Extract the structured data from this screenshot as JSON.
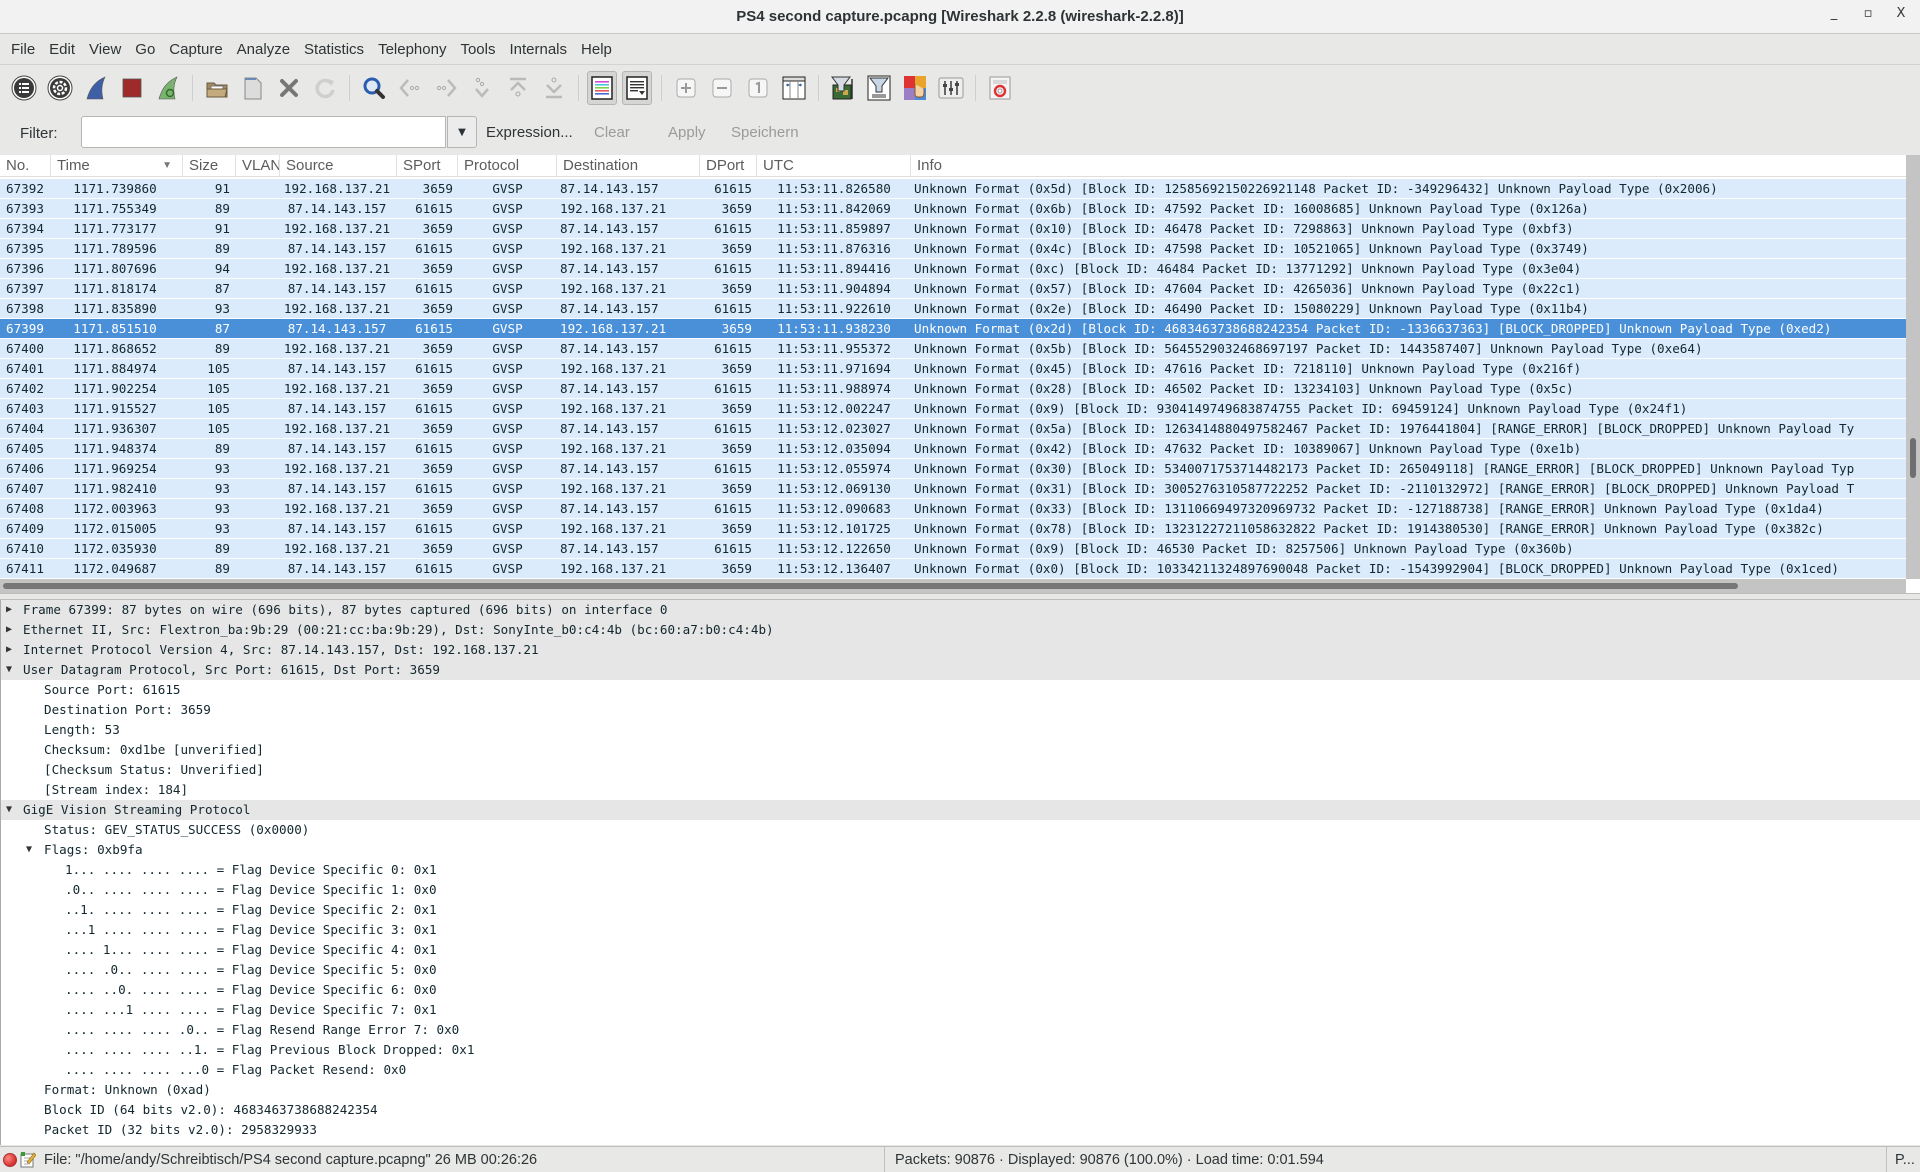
{
  "window": {
    "title": "PS4 second capture.pcapng [Wireshark 2.2.8 (wireshark-2.2.8)]",
    "minimize": "_",
    "maximize": "▫",
    "close": "X"
  },
  "menu": [
    "File",
    "Edit",
    "View",
    "Go",
    "Capture",
    "Analyze",
    "Statistics",
    "Telephony",
    "Tools",
    "Internals",
    "Help"
  ],
  "toolbar": {
    "buttons": [
      "capture-interfaces-icon",
      "capture-options-icon",
      "start-capture-icon",
      "stop-capture-icon",
      "restart-capture-icon",
      "open-file-icon",
      "save-file-icon",
      "close-file-icon",
      "reload-file-icon",
      "find-packet-icon",
      "go-back-icon",
      "go-forward-icon",
      "go-to-packet-icon",
      "go-first-packet-icon",
      "go-last-packet-icon",
      "colorize-icon",
      "auto-scroll-icon",
      "zoom-in-icon",
      "zoom-out-icon",
      "normal-size-icon",
      "resize-columns-icon",
      "capture-filters-icon",
      "display-filters-icon",
      "coloring-rules-icon",
      "preferences-icon",
      "help-icon"
    ]
  },
  "filter": {
    "label": "Filter:",
    "value": "",
    "expression": "Expression...",
    "clear": "Clear",
    "apply": "Apply",
    "save": "Speichern"
  },
  "columns": [
    "No.",
    "Time",
    "Size",
    "VLAN",
    "Source",
    "SPort",
    "Protocol",
    "Destination",
    "DPort",
    "UTC",
    "Info"
  ],
  "packets": [
    {
      "no": "67392",
      "time": "1171.739860",
      "size": "91",
      "vlan": "",
      "src": "192.168.137.21",
      "sport": "3659",
      "proto": "GVSP",
      "dst": "87.14.143.157",
      "dport": "61615",
      "utc": "11:53:11.826580",
      "info": "Unknown Format (0x5d) [Block ID: 12585692150226921148 Packet ID: -349296432] Unknown Payload Type (0x2006)"
    },
    {
      "no": "67393",
      "time": "1171.755349",
      "size": "89",
      "vlan": "",
      "src": "87.14.143.157",
      "sport": "61615",
      "proto": "GVSP",
      "dst": "192.168.137.21",
      "dport": "3659",
      "utc": "11:53:11.842069",
      "info": "Unknown Format (0x6b) [Block ID: 47592 Packet ID: 16008685] Unknown Payload Type (0x126a)"
    },
    {
      "no": "67394",
      "time": "1171.773177",
      "size": "91",
      "vlan": "",
      "src": "192.168.137.21",
      "sport": "3659",
      "proto": "GVSP",
      "dst": "87.14.143.157",
      "dport": "61615",
      "utc": "11:53:11.859897",
      "info": "Unknown Format (0x10) [Block ID: 46478 Packet ID: 7298863] Unknown Payload Type (0xbf3)"
    },
    {
      "no": "67395",
      "time": "1171.789596",
      "size": "89",
      "vlan": "",
      "src": "87.14.143.157",
      "sport": "61615",
      "proto": "GVSP",
      "dst": "192.168.137.21",
      "dport": "3659",
      "utc": "11:53:11.876316",
      "info": "Unknown Format (0x4c) [Block ID: 47598 Packet ID: 10521065] Unknown Payload Type (0x3749)"
    },
    {
      "no": "67396",
      "time": "1171.807696",
      "size": "94",
      "vlan": "",
      "src": "192.168.137.21",
      "sport": "3659",
      "proto": "GVSP",
      "dst": "87.14.143.157",
      "dport": "61615",
      "utc": "11:53:11.894416",
      "info": "Unknown Format (0xc) [Block ID: 46484 Packet ID: 13771292] Unknown Payload Type (0x3e04)"
    },
    {
      "no": "67397",
      "time": "1171.818174",
      "size": "87",
      "vlan": "",
      "src": "87.14.143.157",
      "sport": "61615",
      "proto": "GVSP",
      "dst": "192.168.137.21",
      "dport": "3659",
      "utc": "11:53:11.904894",
      "info": "Unknown Format (0x57) [Block ID: 47604 Packet ID: 4265036] Unknown Payload Type (0x22c1)"
    },
    {
      "no": "67398",
      "time": "1171.835890",
      "size": "93",
      "vlan": "",
      "src": "192.168.137.21",
      "sport": "3659",
      "proto": "GVSP",
      "dst": "87.14.143.157",
      "dport": "61615",
      "utc": "11:53:11.922610",
      "info": "Unknown Format (0x2e) [Block ID: 46490 Packet ID: 15080229] Unknown Payload Type (0x11b4)"
    },
    {
      "no": "67399",
      "time": "1171.851510",
      "size": "87",
      "vlan": "",
      "src": "87.14.143.157",
      "sport": "61615",
      "proto": "GVSP",
      "dst": "192.168.137.21",
      "dport": "3659",
      "utc": "11:53:11.938230",
      "info": "Unknown Format (0x2d) [Block ID: 4683463738688242354 Packet ID: -1336637363] [BLOCK_DROPPED] Unknown Payload Type (0xed2)",
      "selected": true
    },
    {
      "no": "67400",
      "time": "1171.868652",
      "size": "89",
      "vlan": "",
      "src": "192.168.137.21",
      "sport": "3659",
      "proto": "GVSP",
      "dst": "87.14.143.157",
      "dport": "61615",
      "utc": "11:53:11.955372",
      "info": "Unknown Format (0x5b) [Block ID: 5645529032468697197 Packet ID: 1443587407] Unknown Payload Type (0xe64)"
    },
    {
      "no": "67401",
      "time": "1171.884974",
      "size": "105",
      "vlan": "",
      "src": "87.14.143.157",
      "sport": "61615",
      "proto": "GVSP",
      "dst": "192.168.137.21",
      "dport": "3659",
      "utc": "11:53:11.971694",
      "info": "Unknown Format (0x45) [Block ID: 47616 Packet ID: 7218110] Unknown Payload Type (0x216f)"
    },
    {
      "no": "67402",
      "time": "1171.902254",
      "size": "105",
      "vlan": "",
      "src": "192.168.137.21",
      "sport": "3659",
      "proto": "GVSP",
      "dst": "87.14.143.157",
      "dport": "61615",
      "utc": "11:53:11.988974",
      "info": "Unknown Format (0x28) [Block ID: 46502 Packet ID: 13234103] Unknown Payload Type (0x5c)"
    },
    {
      "no": "67403",
      "time": "1171.915527",
      "size": "105",
      "vlan": "",
      "src": "87.14.143.157",
      "sport": "61615",
      "proto": "GVSP",
      "dst": "192.168.137.21",
      "dport": "3659",
      "utc": "11:53:12.002247",
      "info": "Unknown Format (0x9) [Block ID: 9304149749683874755 Packet ID: 69459124] Unknown Payload Type (0x24f1)"
    },
    {
      "no": "67404",
      "time": "1171.936307",
      "size": "105",
      "vlan": "",
      "src": "192.168.137.21",
      "sport": "3659",
      "proto": "GVSP",
      "dst": "87.14.143.157",
      "dport": "61615",
      "utc": "11:53:12.023027",
      "info": "Unknown Format (0x5a) [Block ID: 1263414880497582467 Packet ID: 1976441804] [RANGE_ERROR] [BLOCK_DROPPED] Unknown Payload Ty"
    },
    {
      "no": "67405",
      "time": "1171.948374",
      "size": "89",
      "vlan": "",
      "src": "87.14.143.157",
      "sport": "61615",
      "proto": "GVSP",
      "dst": "192.168.137.21",
      "dport": "3659",
      "utc": "11:53:12.035094",
      "info": "Unknown Format (0x42) [Block ID: 47632 Packet ID: 10389067] Unknown Payload Type (0xe1b)"
    },
    {
      "no": "67406",
      "time": "1171.969254",
      "size": "93",
      "vlan": "",
      "src": "192.168.137.21",
      "sport": "3659",
      "proto": "GVSP",
      "dst": "87.14.143.157",
      "dport": "61615",
      "utc": "11:53:12.055974",
      "info": "Unknown Format (0x30) [Block ID: 5340071753714482173 Packet ID: 265049118] [RANGE_ERROR] [BLOCK_DROPPED] Unknown Payload Typ"
    },
    {
      "no": "67407",
      "time": "1171.982410",
      "size": "93",
      "vlan": "",
      "src": "87.14.143.157",
      "sport": "61615",
      "proto": "GVSP",
      "dst": "192.168.137.21",
      "dport": "3659",
      "utc": "11:53:12.069130",
      "info": "Unknown Format (0x31) [Block ID: 3005276310587722252 Packet ID: -2110132972] [RANGE_ERROR] [BLOCK_DROPPED] Unknown Payload T"
    },
    {
      "no": "67408",
      "time": "1172.003963",
      "size": "93",
      "vlan": "",
      "src": "192.168.137.21",
      "sport": "3659",
      "proto": "GVSP",
      "dst": "87.14.143.157",
      "dport": "61615",
      "utc": "11:53:12.090683",
      "info": "Unknown Format (0x33) [Block ID: 13110669497320969732 Packet ID: -127188738] [RANGE_ERROR] Unknown Payload Type (0x1da4)"
    },
    {
      "no": "67409",
      "time": "1172.015005",
      "size": "93",
      "vlan": "",
      "src": "87.14.143.157",
      "sport": "61615",
      "proto": "GVSP",
      "dst": "192.168.137.21",
      "dport": "3659",
      "utc": "11:53:12.101725",
      "info": "Unknown Format (0x78) [Block ID: 13231227211058632822 Packet ID: 1914380530] [RANGE_ERROR] Unknown Payload Type (0x382c)"
    },
    {
      "no": "67410",
      "time": "1172.035930",
      "size": "89",
      "vlan": "",
      "src": "192.168.137.21",
      "sport": "3659",
      "proto": "GVSP",
      "dst": "87.14.143.157",
      "dport": "61615",
      "utc": "11:53:12.122650",
      "info": "Unknown Format (0x9) [Block ID: 46530 Packet ID: 8257506] Unknown Payload Type (0x360b)"
    },
    {
      "no": "67411",
      "time": "1172.049687",
      "size": "89",
      "vlan": "",
      "src": "87.14.143.157",
      "sport": "61615",
      "proto": "GVSP",
      "dst": "192.168.137.21",
      "dport": "3659",
      "utc": "11:53:12.136407",
      "info": "Unknown Format (0x0) [Block ID: 10334211324897690048 Packet ID: -1543992904] [BLOCK_DROPPED] Unknown Payload Type (0x1ced)"
    }
  ],
  "details": [
    {
      "level": 0,
      "toggle": "collapsed",
      "section": true,
      "text": "Frame 67399: 87 bytes on wire (696 bits), 87 bytes captured (696 bits) on interface 0"
    },
    {
      "level": 0,
      "toggle": "collapsed",
      "section": true,
      "text": "Ethernet II, Src: Flextron_ba:9b:29 (00:21:cc:ba:9b:29), Dst: SonyInte_b0:c4:4b (bc:60:a7:b0:c4:4b)"
    },
    {
      "level": 0,
      "toggle": "collapsed",
      "section": true,
      "text": "Internet Protocol Version 4, Src: 87.14.143.157, Dst: 192.168.137.21"
    },
    {
      "level": 0,
      "toggle": "expanded",
      "section": true,
      "text": "User Datagram Protocol, Src Port: 61615, Dst Port: 3659"
    },
    {
      "level": 1,
      "text": "Source Port: 61615"
    },
    {
      "level": 1,
      "text": "Destination Port: 3659"
    },
    {
      "level": 1,
      "text": "Length: 53"
    },
    {
      "level": 1,
      "text": "Checksum: 0xd1be [unverified]"
    },
    {
      "level": 1,
      "text": "[Checksum Status: Unverified]"
    },
    {
      "level": 1,
      "text": "[Stream index: 184]"
    },
    {
      "level": 0,
      "toggle": "expanded",
      "section": true,
      "text": "GigE Vision Streaming Protocol"
    },
    {
      "level": 1,
      "text": "Status: GEV_STATUS_SUCCESS (0x0000)"
    },
    {
      "level": 1,
      "toggle": "expanded",
      "text": "Flags: 0xb9fa"
    },
    {
      "level": 2,
      "text": "1... .... .... .... = Flag Device Specific 0: 0x1"
    },
    {
      "level": 2,
      "text": ".0.. .... .... .... = Flag Device Specific 1: 0x0"
    },
    {
      "level": 2,
      "text": "..1. .... .... .... = Flag Device Specific 2: 0x1"
    },
    {
      "level": 2,
      "text": "...1 .... .... .... = Flag Device Specific 3: 0x1"
    },
    {
      "level": 2,
      "text": ".... 1... .... .... = Flag Device Specific 4: 0x1"
    },
    {
      "level": 2,
      "text": ".... .0.. .... .... = Flag Device Specific 5: 0x0"
    },
    {
      "level": 2,
      "text": ".... ..0. .... .... = Flag Device Specific 6: 0x0"
    },
    {
      "level": 2,
      "text": ".... ...1 .... .... = Flag Device Specific 7: 0x1"
    },
    {
      "level": 2,
      "text": ".... .... .... .0.. = Flag Resend Range Error 7: 0x0"
    },
    {
      "level": 2,
      "text": ".... .... .... ..1. = Flag Previous Block Dropped: 0x1"
    },
    {
      "level": 2,
      "text": ".... .... .... ...0 = Flag Packet Resend: 0x0"
    },
    {
      "level": 1,
      "text": "Format: Unknown (0xad)"
    },
    {
      "level": 1,
      "text": "Block ID (64 bits v2.0): 4683463738688242354"
    },
    {
      "level": 1,
      "text": "Packet ID (32 bits v2.0): 2958329933"
    }
  ],
  "status": {
    "file": "File: \"/home/andy/Schreibtisch/PS4 second capture.pcapng\" 26 MB 00:26:26",
    "packets": "Packets: 90876 · Displayed: 90876 (100.0%) · Load time: 0:01.594",
    "profile": "P..."
  },
  "colors": {
    "row_bg": "#dbebfb",
    "selected_bg": "#4a90d9",
    "section_bg": "#e6e6e6"
  }
}
